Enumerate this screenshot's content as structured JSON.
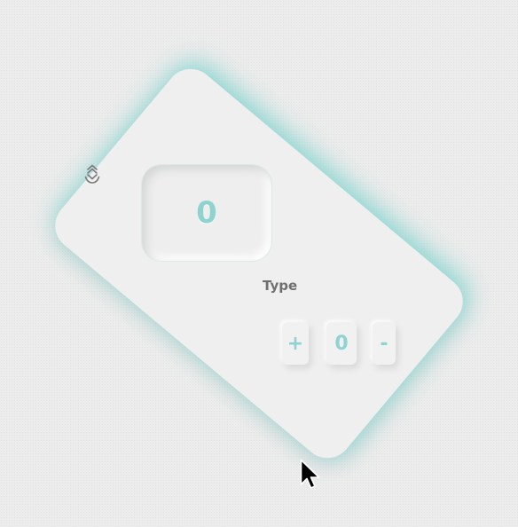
{
  "counter": {
    "display_value": "0",
    "type_label": "Type",
    "keys": {
      "plus": "+",
      "zero": "0",
      "minus": "-"
    }
  },
  "icons": {
    "pin": "swap-vertical-icon",
    "cursor": "mouse-pointer-icon"
  },
  "colors": {
    "accent": "#8fd3d0",
    "glow": "#76d2cc",
    "card": "#efefef",
    "label": "#6f6f6f"
  }
}
